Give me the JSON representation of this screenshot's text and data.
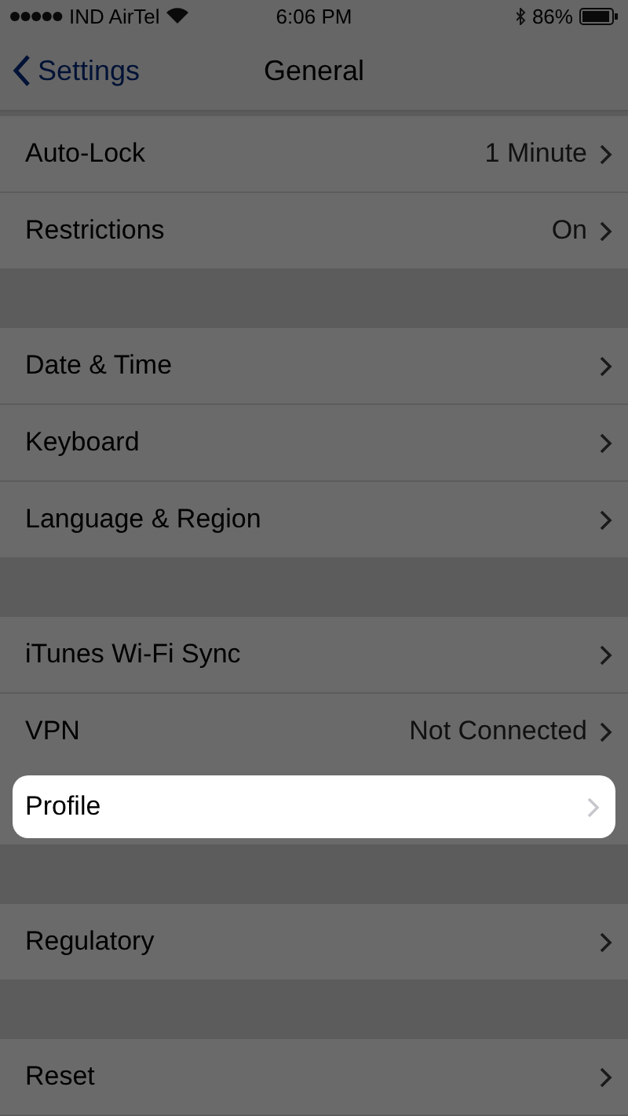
{
  "status_bar": {
    "carrier": "IND AirTel",
    "time": "6:06 PM",
    "battery": "86%"
  },
  "nav": {
    "back": "Settings",
    "title": "General"
  },
  "groups": [
    {
      "rows": [
        {
          "label": "Auto-Lock",
          "value": "1 Minute",
          "selected": false
        },
        {
          "label": "Restrictions",
          "value": "On",
          "selected": false
        }
      ]
    },
    {
      "rows": [
        {
          "label": "Date & Time",
          "selected": false
        },
        {
          "label": "Keyboard",
          "selected": false
        },
        {
          "label": "Language & Region",
          "selected": false
        }
      ]
    },
    {
      "rows": [
        {
          "label": "iTunes Wi-Fi Sync",
          "selected": false
        },
        {
          "label": "VPN",
          "value": "Not Connected",
          "selected": false
        },
        {
          "label": "Profile",
          "selected": true
        }
      ]
    },
    {
      "rows": [
        {
          "label": "Regulatory",
          "selected": false
        }
      ]
    },
    {
      "rows": [
        {
          "label": "Reset",
          "selected": false
        }
      ]
    }
  ]
}
